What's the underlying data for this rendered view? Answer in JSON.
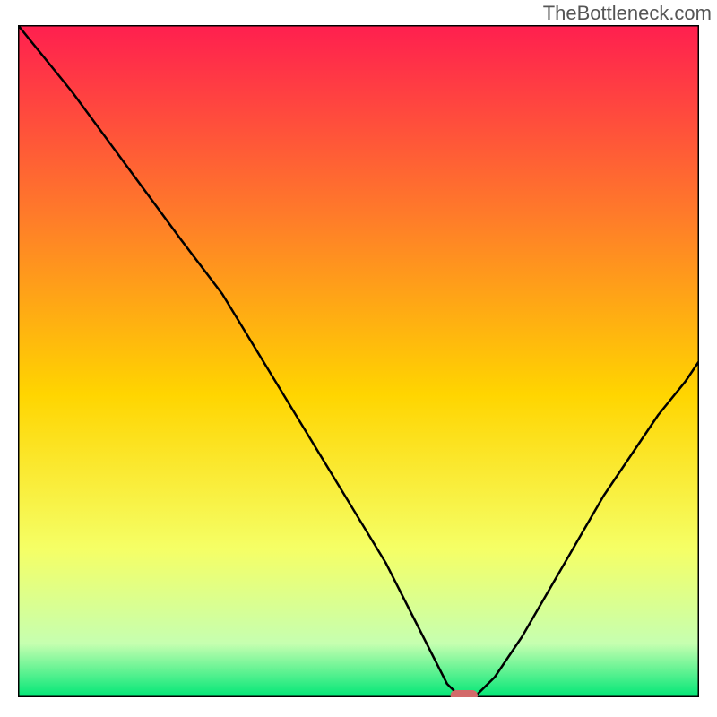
{
  "watermark": "TheBottleneck.com",
  "chart_data": {
    "type": "line",
    "title": "",
    "xlabel": "",
    "ylabel": "",
    "xlim": [
      0,
      100
    ],
    "ylim": [
      0,
      100
    ],
    "background_gradient": {
      "top": "#ff1f4f",
      "upper_mid": "#ff7a2a",
      "mid": "#ffd500",
      "lower_mid": "#f5ff66",
      "near_bottom": "#c6ffb0",
      "bottom": "#00e676"
    },
    "series": [
      {
        "name": "bottleneck-curve",
        "x": [
          0,
          8,
          16,
          24,
          30,
          36,
          42,
          48,
          54,
          58,
          61,
          63,
          65,
          67,
          70,
          74,
          78,
          82,
          86,
          90,
          94,
          98,
          100
        ],
        "y": [
          100,
          90,
          79,
          68,
          60,
          50,
          40,
          30,
          20,
          12,
          6,
          2,
          0,
          0,
          3,
          9,
          16,
          23,
          30,
          36,
          42,
          47,
          50
        ]
      }
    ],
    "marker": {
      "name": "optimal-marker",
      "x": 65.5,
      "y": 0,
      "width": 4,
      "height": 1.6,
      "color": "#d36a6a"
    }
  }
}
